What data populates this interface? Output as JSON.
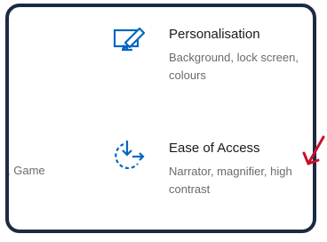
{
  "settings": {
    "personalisation": {
      "title": "Personalisation",
      "desc_line1": "Background, lock screen,",
      "desc_line2": "colours",
      "icon": "personalisation-icon"
    },
    "ease_of_access": {
      "title": "Ease of Access",
      "desc_line1": "Narrator, magnifier, high",
      "desc_line2": "contrast",
      "icon": "ease-of-access-icon"
    },
    "left_partial": {
      "desc": ", Game"
    }
  },
  "colors": {
    "accent": "#0067c0",
    "frame": "#1c2a44",
    "annotation_arrow": "#c8102e"
  }
}
